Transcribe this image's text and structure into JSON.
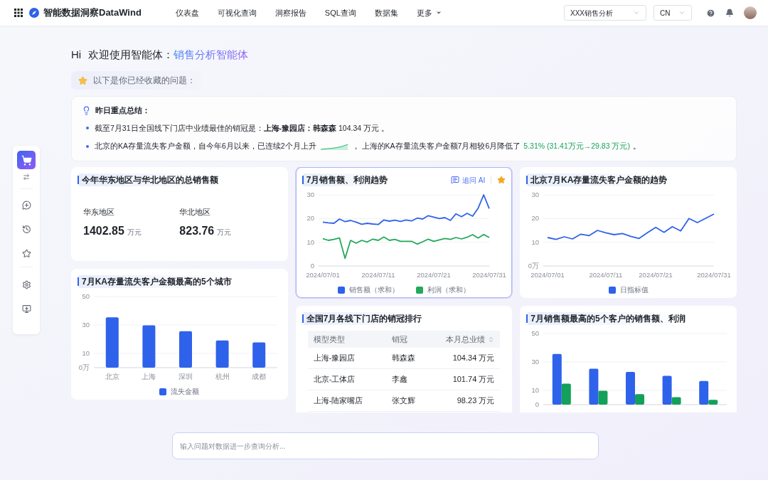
{
  "nav": {
    "brand": "智能数据洞察DataWind",
    "items": [
      {
        "label": "仪表盘",
        "dropdown": false
      },
      {
        "label": "可视化查询",
        "dropdown": false
      },
      {
        "label": "洞察报告",
        "dropdown": false
      },
      {
        "label": "SQL查询",
        "dropdown": false
      },
      {
        "label": "数据集",
        "dropdown": false
      },
      {
        "label": "更多",
        "dropdown": true
      }
    ],
    "workspace": "XXX销售分析",
    "language": "CN"
  },
  "greeting": {
    "hi": "Hi",
    "text": "欢迎使用智能体：",
    "agent": "销售分析智能体"
  },
  "favorites_hint": "以下是你已经收藏的问题：",
  "summary": {
    "title": "昨日重点总结：",
    "items": [
      {
        "kind": "plain",
        "text": "截至7月31日全国线下门店中业绩最佳的销冠是：**上海-豫园店：韩森森** 104.34 万元 。"
      },
      {
        "kind": "trend",
        "text": "北京的KA存量流失客户金额，自今年6月以来，已连续2个月上升",
        "after": "， 上海的KA存量流失客户金额7月相较6月降低了",
        "highlight": "5.31% (31.41万元→29.83 万元)",
        "end": "。"
      }
    ]
  },
  "columns": [
    [
      {
        "kind": "kpi",
        "title": "今年华东地区与华北地区的总销售额",
        "highlighted": false,
        "metrics": [
          {
            "label": "华东地区",
            "value": "1402.85",
            "unit": "万元"
          },
          {
            "label": "华北地区",
            "value": "823.76",
            "unit": "万元"
          }
        ]
      },
      {
        "kind": "chart",
        "title": "7月KA存量流失客户金额最高的5个城市",
        "highlighted": false,
        "chart_data": {
          "type": "bar",
          "categories": [
            "北京",
            "上海",
            "深圳",
            "杭州",
            "成都"
          ],
          "series": [
            {
              "name": "流失金额",
              "color": "#2f62ea",
              "values": [
                35.4,
                29.8,
                25.6,
                19.1,
                17.8
              ]
            }
          ],
          "legend": true,
          "ylim": [
            0,
            50
          ],
          "yticks": [
            {
              "value": 0,
              "label": "0万"
            },
            10,
            30,
            50
          ]
        }
      }
    ],
    [
      {
        "kind": "chart",
        "title": "7月销售额、利润趋势",
        "highlighted": true,
        "ask_ai": "追问 AI",
        "chart_data": {
          "type": "line",
          "categories": [
            "2024/07/01",
            null,
            null,
            null,
            null,
            null,
            null,
            null,
            null,
            null,
            "2024/07/11",
            null,
            null,
            null,
            null,
            null,
            null,
            null,
            null,
            null,
            "2024/07/21",
            null,
            null,
            null,
            null,
            null,
            null,
            null,
            null,
            null,
            "2024/07/31"
          ],
          "series": [
            {
              "name": "销售额（求和）",
              "color": "#2f62ea",
              "values": [
                18.5,
                18.2,
                18,
                19.8,
                18.7,
                19.2,
                18.5,
                17.6,
                18,
                17.7,
                17.5,
                19.4,
                18.9,
                19.3,
                18.8,
                19.4,
                19,
                20.2,
                19.8,
                21.2,
                20.6,
                20,
                20.4,
                19.2,
                22,
                20.8,
                22.2,
                21,
                24.4,
                30,
                24.2
              ]
            },
            {
              "name": "利润（求和）",
              "color": "#22a95a",
              "values": [
                11.5,
                10.8,
                11.2,
                11.8,
                3.2,
                10.8,
                9.6,
                10.8,
                10.1,
                11.3,
                10.8,
                12.2,
                10.8,
                11.2,
                10.4,
                10.4,
                10.4,
                9.2,
                10.2,
                11.3,
                10.4,
                11,
                11.6,
                11.2,
                12,
                11.4,
                12.1,
                13.2,
                11.8,
                13.3,
                12
              ]
            }
          ],
          "legend": true,
          "ylim": [
            0,
            30
          ],
          "yticks": [
            0,
            10,
            20,
            30
          ]
        }
      },
      {
        "kind": "table",
        "title": "全国7月各线下门店的销冠排行",
        "highlighted": false,
        "columns": [
          {
            "label": "模型类型",
            "sortable": false
          },
          {
            "label": "销冠",
            "sortable": false
          },
          {
            "label": "本月总业绩",
            "sortable": true
          }
        ],
        "rows": [
          [
            "上海-豫园店",
            "韩森森",
            "104.34 万元"
          ],
          [
            "北京-工体店",
            "李鑫",
            "101.74 万元"
          ],
          [
            "上海-陆家嘴店",
            "张文辉",
            "98.23 万元"
          ]
        ]
      }
    ],
    [
      {
        "kind": "chart",
        "title": "北京7月KA存量流失客户金额的趋势",
        "highlighted": false,
        "chart_data": {
          "type": "line",
          "categories": [
            "2024/07/01",
            null,
            null,
            null,
            null,
            null,
            null,
            "2024/07/11",
            null,
            null,
            null,
            null,
            null,
            "2024/07/21",
            null,
            null,
            null,
            null,
            null,
            null,
            "2024/07/31"
          ],
          "series": [
            {
              "name": "日指标值",
              "color": "#2f62ea",
              "values": [
                12,
                11.2,
                12.3,
                11.4,
                13.4,
                12.8,
                15,
                14,
                13.2,
                13.7,
                12.5,
                11.6,
                14,
                16.3,
                14.2,
                16.6,
                14.8,
                20,
                18.3,
                20.1,
                21.9
              ]
            }
          ],
          "legend": true,
          "ylim": [
            0,
            30
          ],
          "yticks": [
            {
              "value": 0,
              "label": "0万"
            },
            10,
            20,
            30
          ]
        }
      },
      {
        "kind": "chart",
        "title": "7月销售额最高的5个客户的销售额、利润",
        "highlighted": false,
        "chart_data": {
          "type": "bar",
          "series": [
            {
              "color": "#2f62ea",
              "values": [
                35.6,
                25.3,
                23,
                20.3,
                16.6
              ]
            },
            {
              "color": "#12a05a",
              "values": [
                14.7,
                9.8,
                7.4,
                5.2,
                3.4
              ]
            }
          ],
          "ylim": [
            0,
            50
          ],
          "yticks": [
            0,
            10,
            30,
            50
          ]
        }
      }
    ]
  ],
  "query_input": {
    "placeholder": "输入问题对数据进一步查询分析..."
  }
}
